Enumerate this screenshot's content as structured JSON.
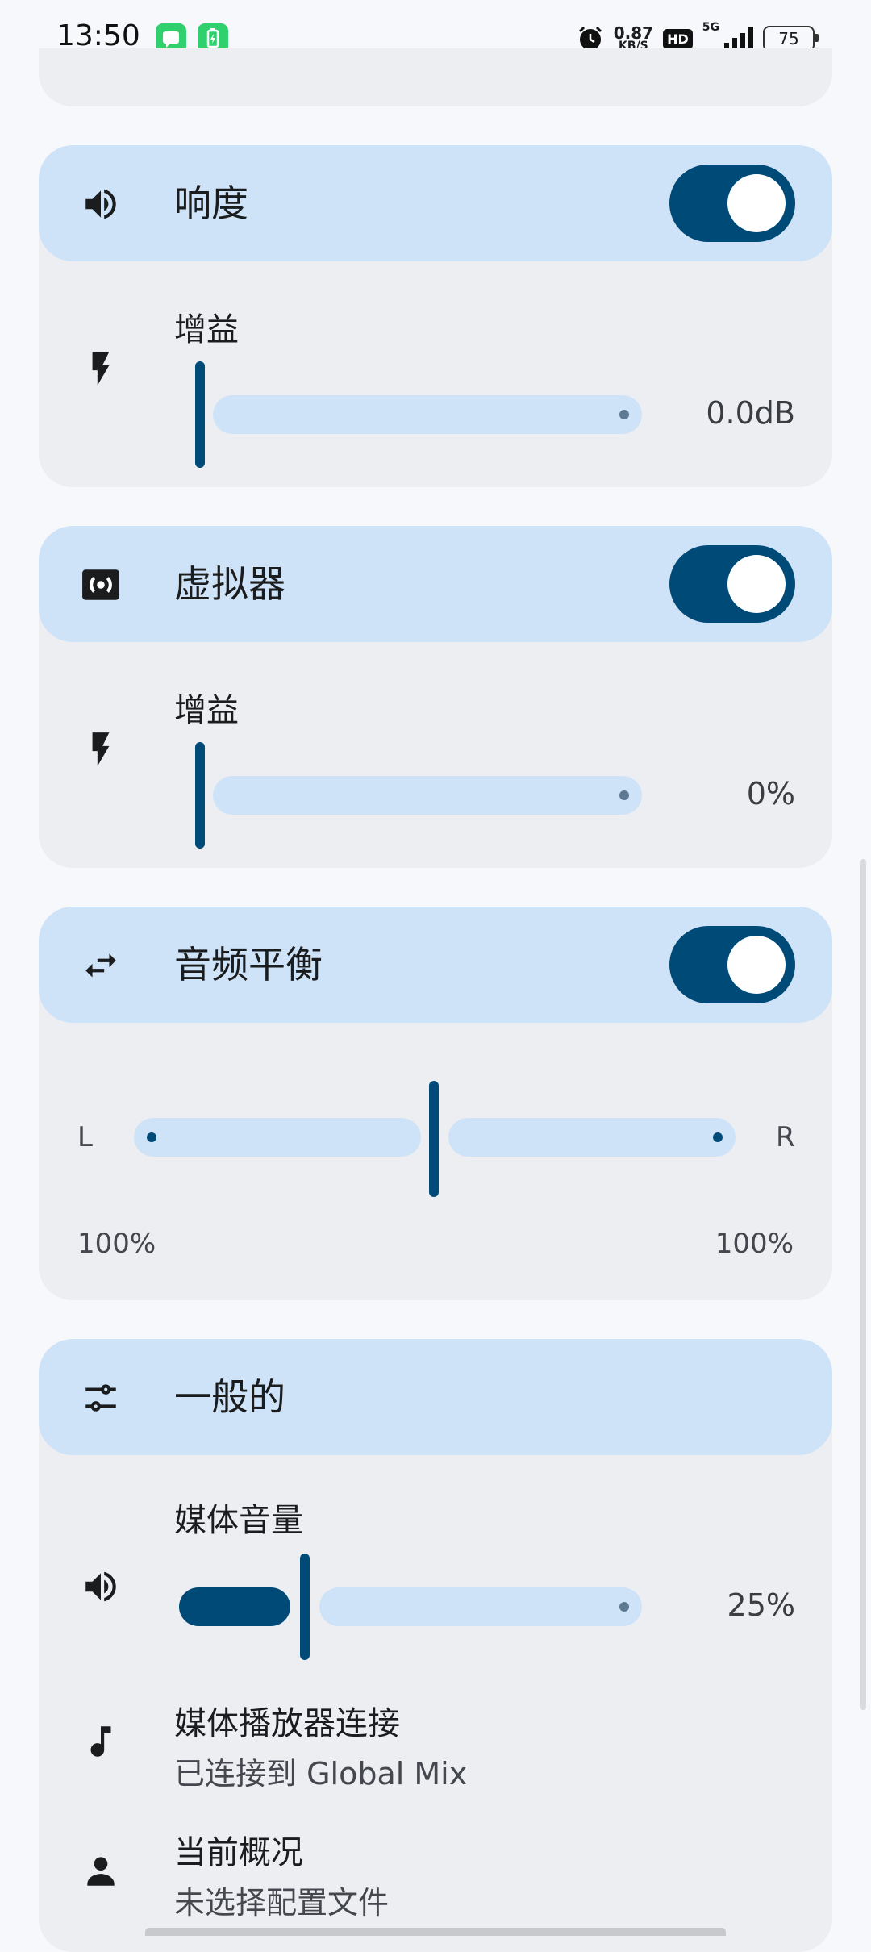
{
  "status_bar": {
    "time": "13:50",
    "speed_value": "0.87",
    "speed_unit": "KB/S",
    "hd": "HD",
    "net": "5G",
    "battery": "75"
  },
  "loudness": {
    "title": "响度",
    "enabled": true,
    "gain_label": "增益",
    "gain_value": "0.0dB"
  },
  "virtualizer": {
    "title": "虚拟器",
    "enabled": true,
    "gain_label": "增益",
    "gain_value": "0%"
  },
  "balance": {
    "title": "音频平衡",
    "enabled": true,
    "left_label": "L",
    "right_label": "R",
    "left_value": "100%",
    "right_value": "100%"
  },
  "general": {
    "title": "一般的",
    "media_volume_label": "媒体音量",
    "media_volume_value": "25%",
    "media_volume_fraction": 0.25,
    "player_label": "媒体播放器连接",
    "player_value": "已连接到 Global Mix",
    "profile_label": "当前概况",
    "profile_value": "未选择配置文件"
  },
  "colors": {
    "accent": "#004a77",
    "header_bg": "#cfe3f8",
    "card_bg": "#eceef2"
  }
}
